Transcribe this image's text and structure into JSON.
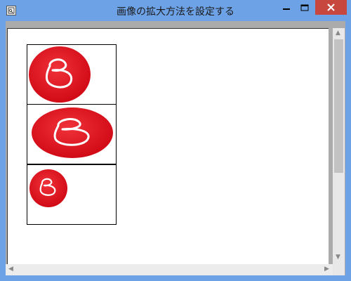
{
  "window": {
    "title": "画像の拡大方法を設定する"
  },
  "titlebar_buttons": {
    "minimize_icon": "minimize-icon",
    "maximize_icon": "maximize-icon",
    "close_icon": "close-icon"
  },
  "images": [
    {
      "name": "logo-stretched-fit",
      "icon": "b-logo"
    },
    {
      "name": "logo-stretched-wide",
      "icon": "b-logo"
    },
    {
      "name": "logo-original-size",
      "icon": "b-logo"
    }
  ],
  "colors": {
    "titlebar": "#6ea2e6",
    "close_button": "#c7463e",
    "logo_red": "#e3151f",
    "client_background": "#ffffff"
  }
}
